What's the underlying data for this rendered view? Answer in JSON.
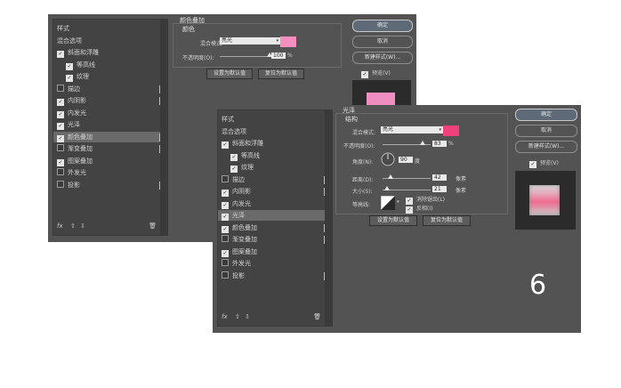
{
  "styles_list": [
    {
      "label": "样式",
      "checkbox": false,
      "checked": false,
      "plus": false,
      "sub": false
    },
    {
      "label": "混合选项",
      "checkbox": false,
      "checked": false,
      "plus": false,
      "sub": false
    },
    {
      "label": "斜面和浮雕",
      "checkbox": true,
      "checked": true,
      "plus": false,
      "sub": false
    },
    {
      "label": "等高线",
      "checkbox": true,
      "checked": true,
      "plus": false,
      "sub": true
    },
    {
      "label": "纹理",
      "checkbox": true,
      "checked": true,
      "plus": false,
      "sub": true
    },
    {
      "label": "描边",
      "checkbox": true,
      "checked": false,
      "plus": true,
      "sub": false
    },
    {
      "label": "内阴影",
      "checkbox": true,
      "checked": true,
      "plus": true,
      "sub": false
    },
    {
      "label": "内发光",
      "checkbox": true,
      "checked": true,
      "plus": false,
      "sub": false
    },
    {
      "label": "光泽",
      "checkbox": true,
      "checked": true,
      "plus": false,
      "sub": false
    },
    {
      "label": "颜色叠加",
      "checkbox": true,
      "checked": true,
      "plus": true,
      "sub": false
    },
    {
      "label": "渐变叠加",
      "checkbox": true,
      "checked": false,
      "plus": true,
      "sub": false
    },
    {
      "label": "图案叠加",
      "checkbox": true,
      "checked": true,
      "plus": false,
      "sub": false
    },
    {
      "label": "外发光",
      "checkbox": true,
      "checked": false,
      "plus": false,
      "sub": false
    },
    {
      "label": "投影",
      "checkbox": true,
      "checked": false,
      "plus": true,
      "sub": false
    }
  ],
  "fx_label": "fx",
  "back": {
    "section_title": "颜色叠加",
    "group_title": "颜色",
    "blend_label": "混合模式:",
    "blend_value": "亮光",
    "opacity_label": "不透明度(O):",
    "opacity_value": "100",
    "opacity_fraction": 1.0,
    "unit_percent": "%",
    "swatch_color": "#f58fc0",
    "btn_default": "设置为默认值",
    "btn_reset": "复位为默认值",
    "ok": "确定",
    "cancel": "取消",
    "new_style": "新建样式(W)...",
    "preview_label": "预览(V)"
  },
  "front": {
    "section_title": "光泽",
    "group_title": "结构",
    "blend_label": "混合模式:",
    "blend_value": "亮光",
    "opacity_label": "不透明度(O):",
    "opacity_value": "83",
    "opacity_fraction": 0.83,
    "unit_percent": "%",
    "swatch_color": "#f0417a",
    "angle_label": "角度(N):",
    "angle_value": "90",
    "angle_unit": "度",
    "distance_label": "距离(D):",
    "distance_value": "42",
    "distance_unit": "像素",
    "distance_fraction": 0.17,
    "size_label": "大小(S):",
    "size_value": "21",
    "size_unit": "像素",
    "size_fraction": 0.09,
    "contour_label": "等高线:",
    "antialias_label": "消除锯齿(L)",
    "invert_label": "反相(I)",
    "btn_default": "设置为默认值",
    "btn_reset": "复位为默认值",
    "ok": "确定",
    "cancel": "取消",
    "new_style": "新建样式(W)...",
    "preview_label": "预览(V)"
  },
  "step_number": "6"
}
